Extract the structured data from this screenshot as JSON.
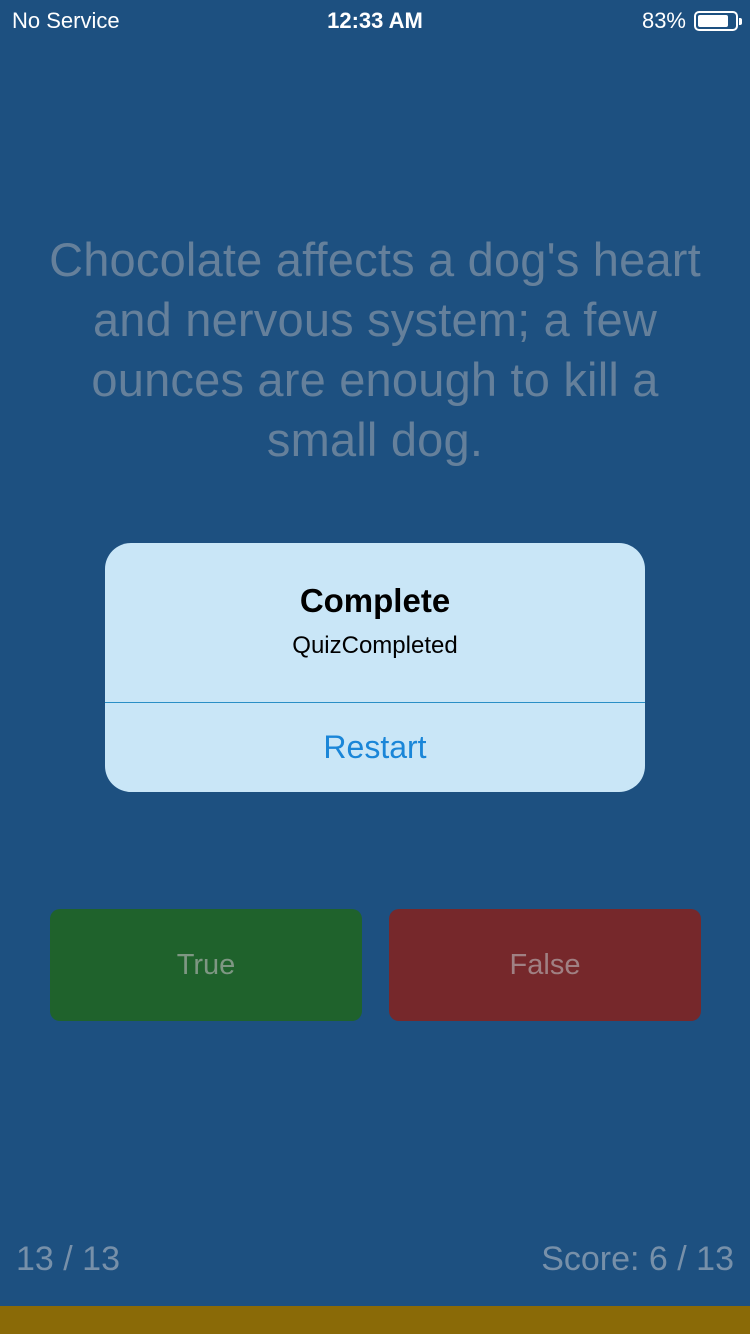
{
  "status_bar": {
    "carrier": "No Service",
    "time": "12:33 AM",
    "battery": "83%",
    "battery_level": 0.83
  },
  "question": {
    "text": "Chocolate affects a dog's heart and nervous system; a few ounces are enough to kill a small dog."
  },
  "answers": {
    "true_label": "True",
    "false_label": "False"
  },
  "footer": {
    "progress": "13 / 13",
    "score": "Score: 6 / 13",
    "progress_fraction": 1.0
  },
  "alert": {
    "title": "Complete",
    "message": "QuizCompleted",
    "button_label": "Restart"
  },
  "colors": {
    "background": "#1d5080",
    "true_button": "#1f622c",
    "false_button": "#76282b",
    "alert_background": "#c9e6f7",
    "alert_button_text": "#1a86d8",
    "progress_fill": "#8a6a07"
  },
  "icons": {
    "battery": "battery-icon"
  }
}
